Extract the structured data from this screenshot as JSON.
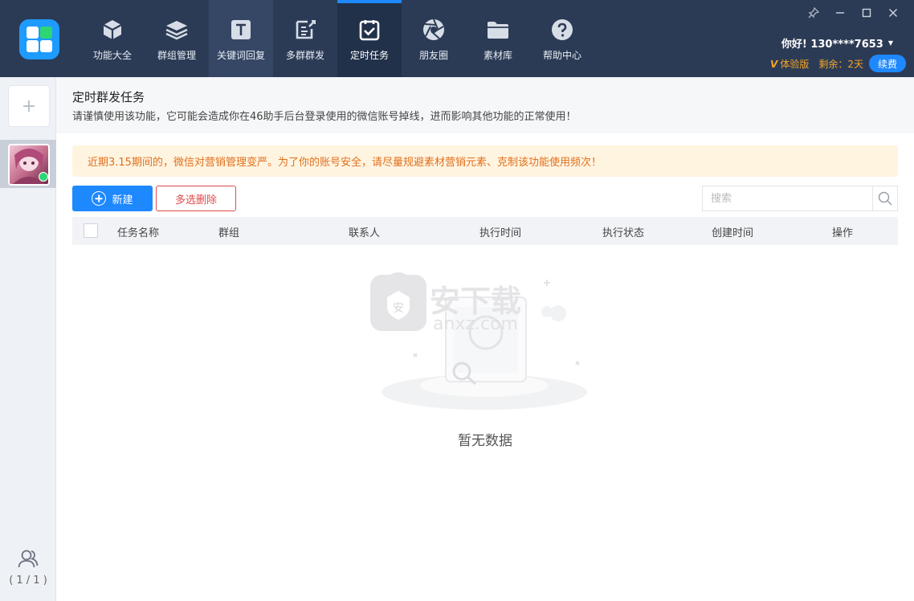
{
  "nav": {
    "items": [
      {
        "label": "功能大全",
        "icon": "cube-icon"
      },
      {
        "label": "群组管理",
        "icon": "layers-icon"
      },
      {
        "label": "关键词回复",
        "icon": "text-t-icon"
      },
      {
        "label": "多群群发",
        "icon": "edit-doc-icon"
      },
      {
        "label": "定时任务",
        "icon": "clipboard-check-icon"
      },
      {
        "label": "朋友圈",
        "icon": "aperture-icon"
      },
      {
        "label": "素材库",
        "icon": "folder-icon"
      },
      {
        "label": "帮助中心",
        "icon": "help-icon"
      }
    ],
    "active": "定时任务"
  },
  "user": {
    "greeting": "你好! 130****7653",
    "edition": "体验版",
    "remaining": "剩余：2天",
    "renew": "续费"
  },
  "sidebar": {
    "add": "+",
    "page_count": "( 1 / 1 )"
  },
  "header": {
    "title": "定时群发任务",
    "description": "请谨慎使用该功能，它可能会造成你在46助手后台登录使用的微信账号掉线，进而影响其他功能的正常使用！"
  },
  "notice": "近期3.15期间的，微信对营销管理变严。为了你的账号安全，请尽量规避素材营销元素、克制该功能使用频次！",
  "toolbar": {
    "new": "新建",
    "multi_delete": "多选删除",
    "search_placeholder": "搜索"
  },
  "table": {
    "columns": [
      "任务名称",
      "群组",
      "联系人",
      "执行时间",
      "执行状态",
      "创建时间",
      "操作"
    ]
  },
  "empty_text": "暂无数据",
  "watermark": "安下载 anxz.com",
  "colors": {
    "topbar": "#2c3b55",
    "accent": "#1e88ff",
    "notice_bg": "#fff4e0",
    "notice_text": "#e0701e",
    "danger": "#e14a4a"
  }
}
